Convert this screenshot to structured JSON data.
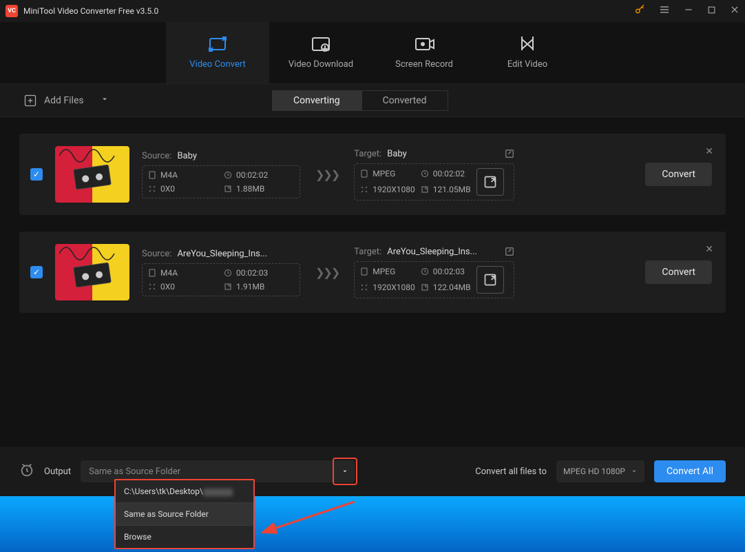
{
  "titlebar": {
    "app_title": "MiniTool Video Converter Free v3.5.0",
    "logo_text": "VC"
  },
  "nav": {
    "items": [
      {
        "label": "Video Convert",
        "active": true
      },
      {
        "label": "Video Download"
      },
      {
        "label": "Screen Record"
      },
      {
        "label": "Edit Video"
      }
    ]
  },
  "toolbar": {
    "add_files": "Add Files",
    "tabs": {
      "converting": "Converting",
      "converted": "Converted"
    }
  },
  "items": [
    {
      "source_label": "Source:",
      "source_name": "Baby",
      "src_format": "M4A",
      "src_duration": "00:02:02",
      "src_res": "0X0",
      "src_size": "1.88MB",
      "target_label": "Target:",
      "target_name": "Baby",
      "tgt_format": "MPEG",
      "tgt_duration": "00:02:02",
      "tgt_res": "1920X1080",
      "tgt_size": "121.05MB",
      "convert": "Convert"
    },
    {
      "source_label": "Source:",
      "source_name": "AreYou_Sleeping_Ins...",
      "src_format": "M4A",
      "src_duration": "00:02:03",
      "src_res": "0X0",
      "src_size": "1.91MB",
      "target_label": "Target:",
      "target_name": "AreYou_Sleeping_Ins...",
      "tgt_format": "MPEG",
      "tgt_duration": "00:02:03",
      "tgt_res": "1920X1080",
      "tgt_size": "122.04MB",
      "convert": "Convert"
    }
  ],
  "footer": {
    "output_label": "Output",
    "output_value": "Same as Source Folder",
    "convert_all_label": "Convert all files to",
    "format": "MPEG HD 1080P",
    "convert_all": "Convert All"
  },
  "dropdown": {
    "item0": "C:\\Users\\tk\\Desktop\\",
    "item1": "Same as Source Folder",
    "item2": "Browse"
  }
}
